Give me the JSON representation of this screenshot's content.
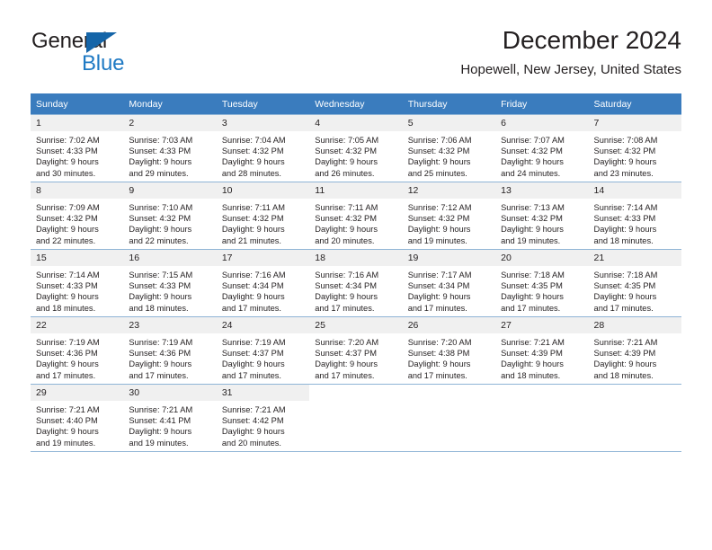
{
  "brand": {
    "name_part1": "General",
    "name_part2": "Blue",
    "logo_icon": "triangle-logo-icon"
  },
  "header": {
    "title": "December 2024",
    "subtitle": "Hopewell, New Jersey, United States"
  },
  "colors": {
    "header_row_bg": "#3a7cbe",
    "day_number_bg": "#f0f0f0",
    "grid_border": "#8fb4d6",
    "brand_blue": "#1f7ac4",
    "brand_triangle": "#1565a8",
    "text": "#231f20"
  },
  "calendar": {
    "weekday_headers": [
      "Sunday",
      "Monday",
      "Tuesday",
      "Wednesday",
      "Thursday",
      "Friday",
      "Saturday"
    ],
    "labels": {
      "sunrise_prefix": "Sunrise:",
      "sunset_prefix": "Sunset:",
      "daylight_prefix": "Daylight:"
    },
    "weeks": [
      [
        {
          "day": "1",
          "sunrise": "Sunrise: 7:02 AM",
          "sunset": "Sunset: 4:33 PM",
          "daylight1": "Daylight: 9 hours",
          "daylight2": "and 30 minutes."
        },
        {
          "day": "2",
          "sunrise": "Sunrise: 7:03 AM",
          "sunset": "Sunset: 4:33 PM",
          "daylight1": "Daylight: 9 hours",
          "daylight2": "and 29 minutes."
        },
        {
          "day": "3",
          "sunrise": "Sunrise: 7:04 AM",
          "sunset": "Sunset: 4:32 PM",
          "daylight1": "Daylight: 9 hours",
          "daylight2": "and 28 minutes."
        },
        {
          "day": "4",
          "sunrise": "Sunrise: 7:05 AM",
          "sunset": "Sunset: 4:32 PM",
          "daylight1": "Daylight: 9 hours",
          "daylight2": "and 26 minutes."
        },
        {
          "day": "5",
          "sunrise": "Sunrise: 7:06 AM",
          "sunset": "Sunset: 4:32 PM",
          "daylight1": "Daylight: 9 hours",
          "daylight2": "and 25 minutes."
        },
        {
          "day": "6",
          "sunrise": "Sunrise: 7:07 AM",
          "sunset": "Sunset: 4:32 PM",
          "daylight1": "Daylight: 9 hours",
          "daylight2": "and 24 minutes."
        },
        {
          "day": "7",
          "sunrise": "Sunrise: 7:08 AM",
          "sunset": "Sunset: 4:32 PM",
          "daylight1": "Daylight: 9 hours",
          "daylight2": "and 23 minutes."
        }
      ],
      [
        {
          "day": "8",
          "sunrise": "Sunrise: 7:09 AM",
          "sunset": "Sunset: 4:32 PM",
          "daylight1": "Daylight: 9 hours",
          "daylight2": "and 22 minutes."
        },
        {
          "day": "9",
          "sunrise": "Sunrise: 7:10 AM",
          "sunset": "Sunset: 4:32 PM",
          "daylight1": "Daylight: 9 hours",
          "daylight2": "and 22 minutes."
        },
        {
          "day": "10",
          "sunrise": "Sunrise: 7:11 AM",
          "sunset": "Sunset: 4:32 PM",
          "daylight1": "Daylight: 9 hours",
          "daylight2": "and 21 minutes."
        },
        {
          "day": "11",
          "sunrise": "Sunrise: 7:11 AM",
          "sunset": "Sunset: 4:32 PM",
          "daylight1": "Daylight: 9 hours",
          "daylight2": "and 20 minutes."
        },
        {
          "day": "12",
          "sunrise": "Sunrise: 7:12 AM",
          "sunset": "Sunset: 4:32 PM",
          "daylight1": "Daylight: 9 hours",
          "daylight2": "and 19 minutes."
        },
        {
          "day": "13",
          "sunrise": "Sunrise: 7:13 AM",
          "sunset": "Sunset: 4:32 PM",
          "daylight1": "Daylight: 9 hours",
          "daylight2": "and 19 minutes."
        },
        {
          "day": "14",
          "sunrise": "Sunrise: 7:14 AM",
          "sunset": "Sunset: 4:33 PM",
          "daylight1": "Daylight: 9 hours",
          "daylight2": "and 18 minutes."
        }
      ],
      [
        {
          "day": "15",
          "sunrise": "Sunrise: 7:14 AM",
          "sunset": "Sunset: 4:33 PM",
          "daylight1": "Daylight: 9 hours",
          "daylight2": "and 18 minutes."
        },
        {
          "day": "16",
          "sunrise": "Sunrise: 7:15 AM",
          "sunset": "Sunset: 4:33 PM",
          "daylight1": "Daylight: 9 hours",
          "daylight2": "and 18 minutes."
        },
        {
          "day": "17",
          "sunrise": "Sunrise: 7:16 AM",
          "sunset": "Sunset: 4:34 PM",
          "daylight1": "Daylight: 9 hours",
          "daylight2": "and 17 minutes."
        },
        {
          "day": "18",
          "sunrise": "Sunrise: 7:16 AM",
          "sunset": "Sunset: 4:34 PM",
          "daylight1": "Daylight: 9 hours",
          "daylight2": "and 17 minutes."
        },
        {
          "day": "19",
          "sunrise": "Sunrise: 7:17 AM",
          "sunset": "Sunset: 4:34 PM",
          "daylight1": "Daylight: 9 hours",
          "daylight2": "and 17 minutes."
        },
        {
          "day": "20",
          "sunrise": "Sunrise: 7:18 AM",
          "sunset": "Sunset: 4:35 PM",
          "daylight1": "Daylight: 9 hours",
          "daylight2": "and 17 minutes."
        },
        {
          "day": "21",
          "sunrise": "Sunrise: 7:18 AM",
          "sunset": "Sunset: 4:35 PM",
          "daylight1": "Daylight: 9 hours",
          "daylight2": "and 17 minutes."
        }
      ],
      [
        {
          "day": "22",
          "sunrise": "Sunrise: 7:19 AM",
          "sunset": "Sunset: 4:36 PM",
          "daylight1": "Daylight: 9 hours",
          "daylight2": "and 17 minutes."
        },
        {
          "day": "23",
          "sunrise": "Sunrise: 7:19 AM",
          "sunset": "Sunset: 4:36 PM",
          "daylight1": "Daylight: 9 hours",
          "daylight2": "and 17 minutes."
        },
        {
          "day": "24",
          "sunrise": "Sunrise: 7:19 AM",
          "sunset": "Sunset: 4:37 PM",
          "daylight1": "Daylight: 9 hours",
          "daylight2": "and 17 minutes."
        },
        {
          "day": "25",
          "sunrise": "Sunrise: 7:20 AM",
          "sunset": "Sunset: 4:37 PM",
          "daylight1": "Daylight: 9 hours",
          "daylight2": "and 17 minutes."
        },
        {
          "day": "26",
          "sunrise": "Sunrise: 7:20 AM",
          "sunset": "Sunset: 4:38 PM",
          "daylight1": "Daylight: 9 hours",
          "daylight2": "and 17 minutes."
        },
        {
          "day": "27",
          "sunrise": "Sunrise: 7:21 AM",
          "sunset": "Sunset: 4:39 PM",
          "daylight1": "Daylight: 9 hours",
          "daylight2": "and 18 minutes."
        },
        {
          "day": "28",
          "sunrise": "Sunrise: 7:21 AM",
          "sunset": "Sunset: 4:39 PM",
          "daylight1": "Daylight: 9 hours",
          "daylight2": "and 18 minutes."
        }
      ],
      [
        {
          "day": "29",
          "sunrise": "Sunrise: 7:21 AM",
          "sunset": "Sunset: 4:40 PM",
          "daylight1": "Daylight: 9 hours",
          "daylight2": "and 19 minutes."
        },
        {
          "day": "30",
          "sunrise": "Sunrise: 7:21 AM",
          "sunset": "Sunset: 4:41 PM",
          "daylight1": "Daylight: 9 hours",
          "daylight2": "and 19 minutes."
        },
        {
          "day": "31",
          "sunrise": "Sunrise: 7:21 AM",
          "sunset": "Sunset: 4:42 PM",
          "daylight1": "Daylight: 9 hours",
          "daylight2": "and 20 minutes."
        },
        {
          "day": "",
          "sunrise": "",
          "sunset": "",
          "daylight1": "",
          "daylight2": ""
        },
        {
          "day": "",
          "sunrise": "",
          "sunset": "",
          "daylight1": "",
          "daylight2": ""
        },
        {
          "day": "",
          "sunrise": "",
          "sunset": "",
          "daylight1": "",
          "daylight2": ""
        },
        {
          "day": "",
          "sunrise": "",
          "sunset": "",
          "daylight1": "",
          "daylight2": ""
        }
      ]
    ]
  }
}
